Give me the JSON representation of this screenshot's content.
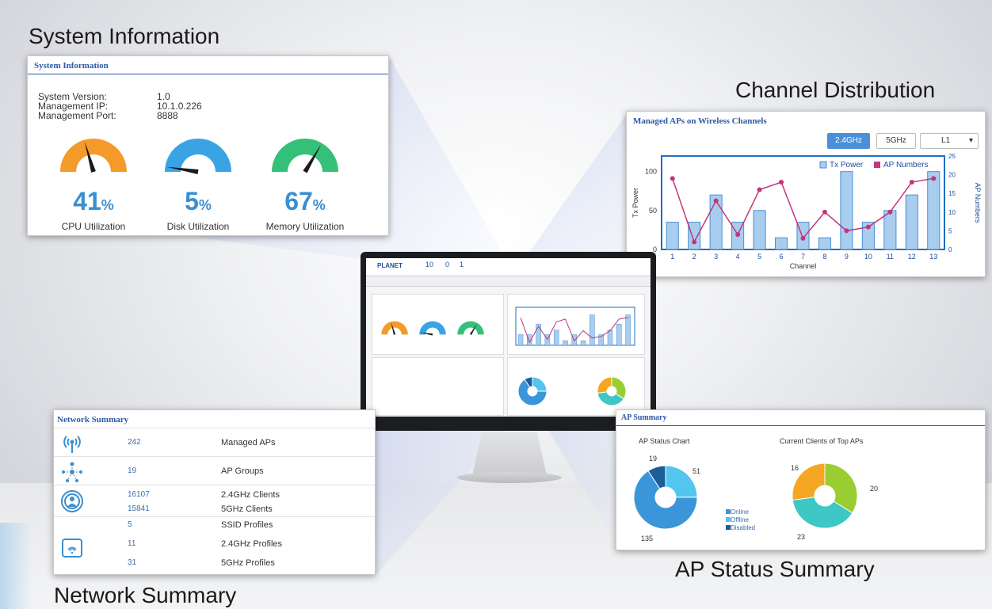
{
  "captions": {
    "system_info": "System Information",
    "channel": "Channel Distribution",
    "network": "Network Summary",
    "ap_status": "AP Status Summary"
  },
  "system_info": {
    "title": "System Information",
    "version_label": "System Version:",
    "version_value": "1.0",
    "ip_label": "Management IP:",
    "ip_value": "10.1.0.226",
    "port_label": "Management Port:",
    "port_value": "8888",
    "gauges": [
      {
        "value": "41",
        "unit": "%",
        "label": "CPU Utilization",
        "percent": 41,
        "color": "#f39a2b"
      },
      {
        "value": "5",
        "unit": "%",
        "label": "Disk Utilization",
        "percent": 5,
        "color": "#3aa3e3"
      },
      {
        "value": "67",
        "unit": "%",
        "label": "Memory Utilization",
        "percent": 67,
        "color": "#35c07a"
      }
    ]
  },
  "channel_panel": {
    "title": "Managed APs on Wireless Channels",
    "btn_24": "2.4GHz",
    "btn_5": "5GHz",
    "select_value": "L1",
    "legend_tx": "Tx Power",
    "legend_ap": "AP Numbers",
    "ylabel_left": "Tx Power",
    "ylabel_right": "AP Numbers",
    "xlabel": "Channel",
    "colors": {
      "bar": "#a9cdef",
      "bar_stroke": "#4a8fd1",
      "line": "#c2357b",
      "frame": "#1f6fc0"
    }
  },
  "chart_data": [
    {
      "type": "bar",
      "title": "Managed APs on Wireless Channels",
      "xlabel": "Channel",
      "ylabel": "Tx Power",
      "categories": [
        "1",
        "2",
        "3",
        "4",
        "5",
        "6",
        "7",
        "8",
        "9",
        "10",
        "11",
        "12",
        "13"
      ],
      "ylim": [
        0,
        120
      ],
      "y2lim": [
        0,
        25
      ],
      "yticks": [
        "0",
        "50",
        "100"
      ],
      "y2ticks": [
        "0",
        "5",
        "10",
        "15",
        "20",
        "25"
      ],
      "series": [
        {
          "name": "Tx Power",
          "axis": "left",
          "type": "bar",
          "values": [
            35,
            35,
            70,
            35,
            50,
            15,
            35,
            15,
            100,
            35,
            50,
            70,
            100
          ]
        },
        {
          "name": "AP Numbers",
          "axis": "right",
          "type": "line",
          "values": [
            19,
            2,
            13,
            4,
            16,
            18,
            3,
            10,
            5,
            6,
            10,
            18,
            19
          ]
        }
      ],
      "legend": "top-right",
      "grid": false
    },
    {
      "type": "pie",
      "title": "AP Status Chart",
      "categories": [
        "Online",
        "Offline",
        "Disabled"
      ],
      "values": [
        135,
        51,
        19
      ],
      "colors": [
        "#3a96d8",
        "#53c5ee",
        "#1d5e9a"
      ]
    },
    {
      "type": "pie",
      "title": "Current Clients of Top APs",
      "categories": [
        "",
        "",
        ""
      ],
      "values": [
        20,
        23,
        16
      ],
      "colors": [
        "#9acd32",
        "#3dc7c5",
        "#f5a623"
      ]
    }
  ],
  "network_summary": {
    "title": "Network Summary",
    "rows": [
      {
        "num": "242",
        "label": "Managed APs"
      },
      {
        "num": "19",
        "label": "AP Groups"
      },
      {
        "num": "16107",
        "label": "2.4GHz Clients"
      },
      {
        "num": "15841",
        "label": "5GHz Clients"
      },
      {
        "num": "5",
        "label": "SSID Profiles"
      },
      {
        "num": "11",
        "label": "2.4GHz Profiles"
      },
      {
        "num": "31",
        "label": "5GHz Profiles"
      }
    ]
  },
  "ap_summary": {
    "title": "AP Summary",
    "status_title": "AP Status Chart",
    "clients_title": "Current Clients of Top APs",
    "legend": [
      "Online",
      "Offline",
      "Disabled"
    ],
    "status_labels": {
      "disabled": "19",
      "offline": "51",
      "online": "135"
    },
    "client_labels": {
      "a": "16",
      "b": "20",
      "c": "23"
    }
  },
  "monitor": {
    "logo": "PLANET",
    "stats": [
      "10",
      "0",
      "1"
    ]
  }
}
